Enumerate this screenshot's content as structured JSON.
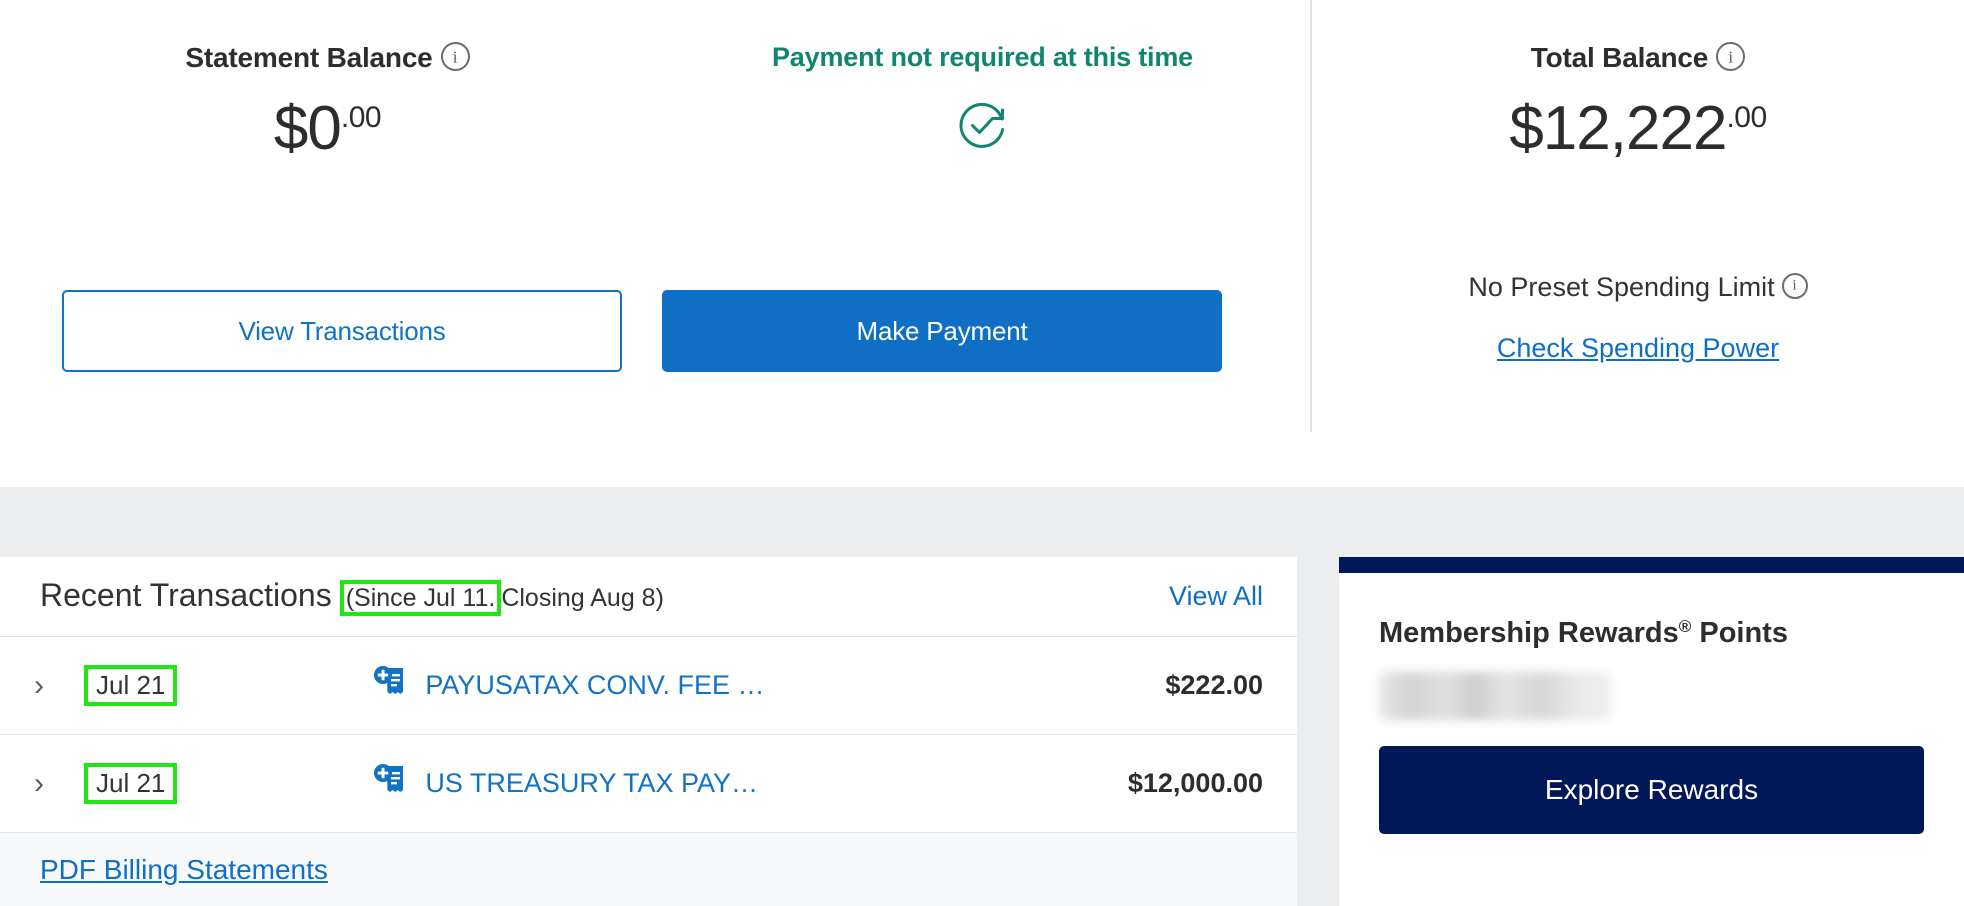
{
  "summary": {
    "statement": {
      "title": "Statement Balance",
      "info_icon": "info-icon",
      "amount_main": "$0",
      "amount_cents": ".00"
    },
    "payment": {
      "status_text": "Payment not required at this time",
      "status_icon": "check-circle-refresh-icon",
      "status_color": "#11866f"
    },
    "total": {
      "title": "Total Balance",
      "info_icon": "info-icon",
      "amount_main": "$12,222",
      "amount_cents": ".00",
      "limit_text": "No Preset Spending Limit",
      "limit_info_icon": "info-icon",
      "spending_power_link": "Check Spending Power"
    },
    "actions": {
      "view_transactions": "View Transactions",
      "make_payment": "Make Payment",
      "primary_color": "#0f6fc5",
      "outline_color": "#1272c4"
    }
  },
  "transactions": {
    "title": "Recent Transactions",
    "since_text": "(Since Jul 11.",
    "closing_text": "Closing Aug 8)",
    "view_all": "View All",
    "highlight_color": "#22e515",
    "rows": [
      {
        "expand_icon": "chevron-right-icon",
        "date": "Jul 21",
        "merchant_icon": "receipt-plus-icon",
        "description": "PAYUSATAX CONV. FEE …",
        "amount": "$222.00"
      },
      {
        "expand_icon": "chevron-right-icon",
        "date": "Jul 21",
        "merchant_icon": "receipt-plus-icon",
        "description": "US TREASURY TAX PAY…",
        "amount": "$12,000.00"
      }
    ],
    "pdf_link": "PDF Billing Statements"
  },
  "rewards": {
    "title_main": "Membership Rewards",
    "title_sup": "®",
    "title_tail": " Points",
    "points_value": "",
    "explore_button": "Explore Rewards",
    "brand_color": "#00175a"
  }
}
